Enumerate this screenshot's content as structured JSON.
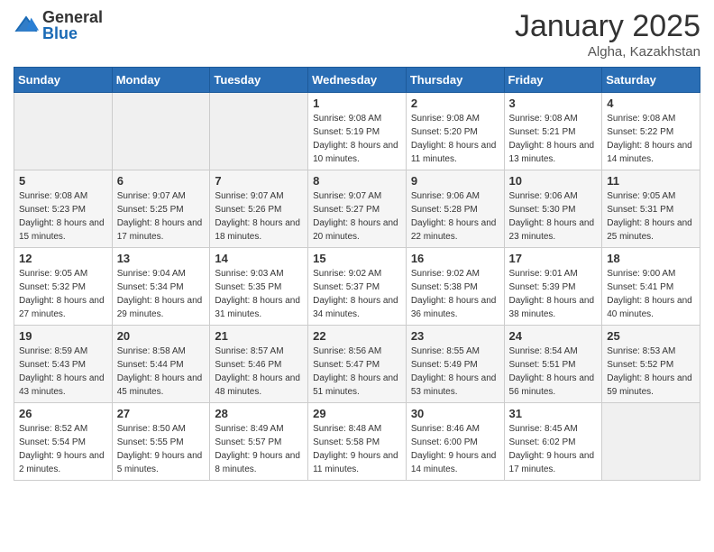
{
  "header": {
    "logo": {
      "general": "General",
      "blue": "Blue"
    },
    "month": "January 2025",
    "location": "Algha, Kazakhstan"
  },
  "days_of_week": [
    "Sunday",
    "Monday",
    "Tuesday",
    "Wednesday",
    "Thursday",
    "Friday",
    "Saturday"
  ],
  "weeks": [
    [
      {
        "day": "",
        "empty": true
      },
      {
        "day": "",
        "empty": true
      },
      {
        "day": "",
        "empty": true
      },
      {
        "day": "1",
        "sunrise": "9:08 AM",
        "sunset": "5:19 PM",
        "daylight": "8 hours and 10 minutes."
      },
      {
        "day": "2",
        "sunrise": "9:08 AM",
        "sunset": "5:20 PM",
        "daylight": "8 hours and 11 minutes."
      },
      {
        "day": "3",
        "sunrise": "9:08 AM",
        "sunset": "5:21 PM",
        "daylight": "8 hours and 13 minutes."
      },
      {
        "day": "4",
        "sunrise": "9:08 AM",
        "sunset": "5:22 PM",
        "daylight": "8 hours and 14 minutes."
      }
    ],
    [
      {
        "day": "5",
        "sunrise": "9:08 AM",
        "sunset": "5:23 PM",
        "daylight": "8 hours and 15 minutes."
      },
      {
        "day": "6",
        "sunrise": "9:07 AM",
        "sunset": "5:25 PM",
        "daylight": "8 hours and 17 minutes."
      },
      {
        "day": "7",
        "sunrise": "9:07 AM",
        "sunset": "5:26 PM",
        "daylight": "8 hours and 18 minutes."
      },
      {
        "day": "8",
        "sunrise": "9:07 AM",
        "sunset": "5:27 PM",
        "daylight": "8 hours and 20 minutes."
      },
      {
        "day": "9",
        "sunrise": "9:06 AM",
        "sunset": "5:28 PM",
        "daylight": "8 hours and 22 minutes."
      },
      {
        "day": "10",
        "sunrise": "9:06 AM",
        "sunset": "5:30 PM",
        "daylight": "8 hours and 23 minutes."
      },
      {
        "day": "11",
        "sunrise": "9:05 AM",
        "sunset": "5:31 PM",
        "daylight": "8 hours and 25 minutes."
      }
    ],
    [
      {
        "day": "12",
        "sunrise": "9:05 AM",
        "sunset": "5:32 PM",
        "daylight": "8 hours and 27 minutes."
      },
      {
        "day": "13",
        "sunrise": "9:04 AM",
        "sunset": "5:34 PM",
        "daylight": "8 hours and 29 minutes."
      },
      {
        "day": "14",
        "sunrise": "9:03 AM",
        "sunset": "5:35 PM",
        "daylight": "8 hours and 31 minutes."
      },
      {
        "day": "15",
        "sunrise": "9:02 AM",
        "sunset": "5:37 PM",
        "daylight": "8 hours and 34 minutes."
      },
      {
        "day": "16",
        "sunrise": "9:02 AM",
        "sunset": "5:38 PM",
        "daylight": "8 hours and 36 minutes."
      },
      {
        "day": "17",
        "sunrise": "9:01 AM",
        "sunset": "5:39 PM",
        "daylight": "8 hours and 38 minutes."
      },
      {
        "day": "18",
        "sunrise": "9:00 AM",
        "sunset": "5:41 PM",
        "daylight": "8 hours and 40 minutes."
      }
    ],
    [
      {
        "day": "19",
        "sunrise": "8:59 AM",
        "sunset": "5:43 PM",
        "daylight": "8 hours and 43 minutes."
      },
      {
        "day": "20",
        "sunrise": "8:58 AM",
        "sunset": "5:44 PM",
        "daylight": "8 hours and 45 minutes."
      },
      {
        "day": "21",
        "sunrise": "8:57 AM",
        "sunset": "5:46 PM",
        "daylight": "8 hours and 48 minutes."
      },
      {
        "day": "22",
        "sunrise": "8:56 AM",
        "sunset": "5:47 PM",
        "daylight": "8 hours and 51 minutes."
      },
      {
        "day": "23",
        "sunrise": "8:55 AM",
        "sunset": "5:49 PM",
        "daylight": "8 hours and 53 minutes."
      },
      {
        "day": "24",
        "sunrise": "8:54 AM",
        "sunset": "5:51 PM",
        "daylight": "8 hours and 56 minutes."
      },
      {
        "day": "25",
        "sunrise": "8:53 AM",
        "sunset": "5:52 PM",
        "daylight": "8 hours and 59 minutes."
      }
    ],
    [
      {
        "day": "26",
        "sunrise": "8:52 AM",
        "sunset": "5:54 PM",
        "daylight": "9 hours and 2 minutes."
      },
      {
        "day": "27",
        "sunrise": "8:50 AM",
        "sunset": "5:55 PM",
        "daylight": "9 hours and 5 minutes."
      },
      {
        "day": "28",
        "sunrise": "8:49 AM",
        "sunset": "5:57 PM",
        "daylight": "9 hours and 8 minutes."
      },
      {
        "day": "29",
        "sunrise": "8:48 AM",
        "sunset": "5:58 PM",
        "daylight": "9 hours and 11 minutes."
      },
      {
        "day": "30",
        "sunrise": "8:46 AM",
        "sunset": "6:00 PM",
        "daylight": "9 hours and 14 minutes."
      },
      {
        "day": "31",
        "sunrise": "8:45 AM",
        "sunset": "6:02 PM",
        "daylight": "9 hours and 17 minutes."
      },
      {
        "day": "",
        "empty": true
      }
    ]
  ]
}
